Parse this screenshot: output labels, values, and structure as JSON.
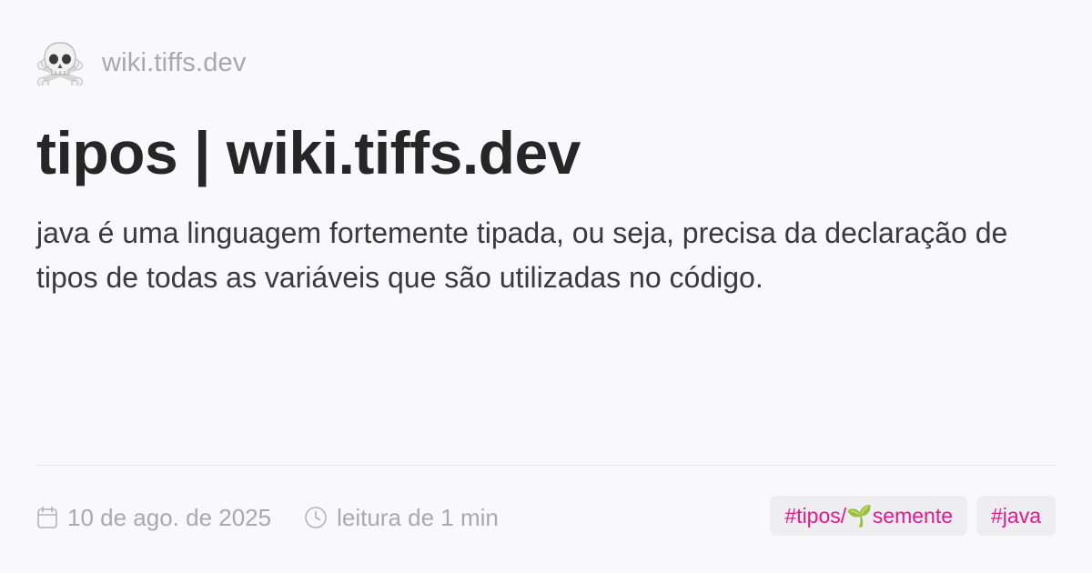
{
  "header": {
    "icon": "skull-crossbones-icon",
    "site_name": "wiki.tiffs.dev"
  },
  "title": "tipos | wiki.tiffs.dev",
  "description": "java é uma linguagem fortemente tipada, ou seja, precisa da declaração de tipos de todas as variáveis que são utilizadas no código.",
  "meta": {
    "date_icon": "calendar-icon",
    "date": "10 de ago. de 2025",
    "reading_icon": "clock-icon",
    "reading_time": "leitura de 1 min"
  },
  "tags": [
    {
      "label": "#tipos/🌱semente"
    },
    {
      "label": "#java"
    }
  ],
  "colors": {
    "background": "#f9f8fa",
    "tag_text": "#e2198f",
    "muted": "#a9a9ae"
  }
}
